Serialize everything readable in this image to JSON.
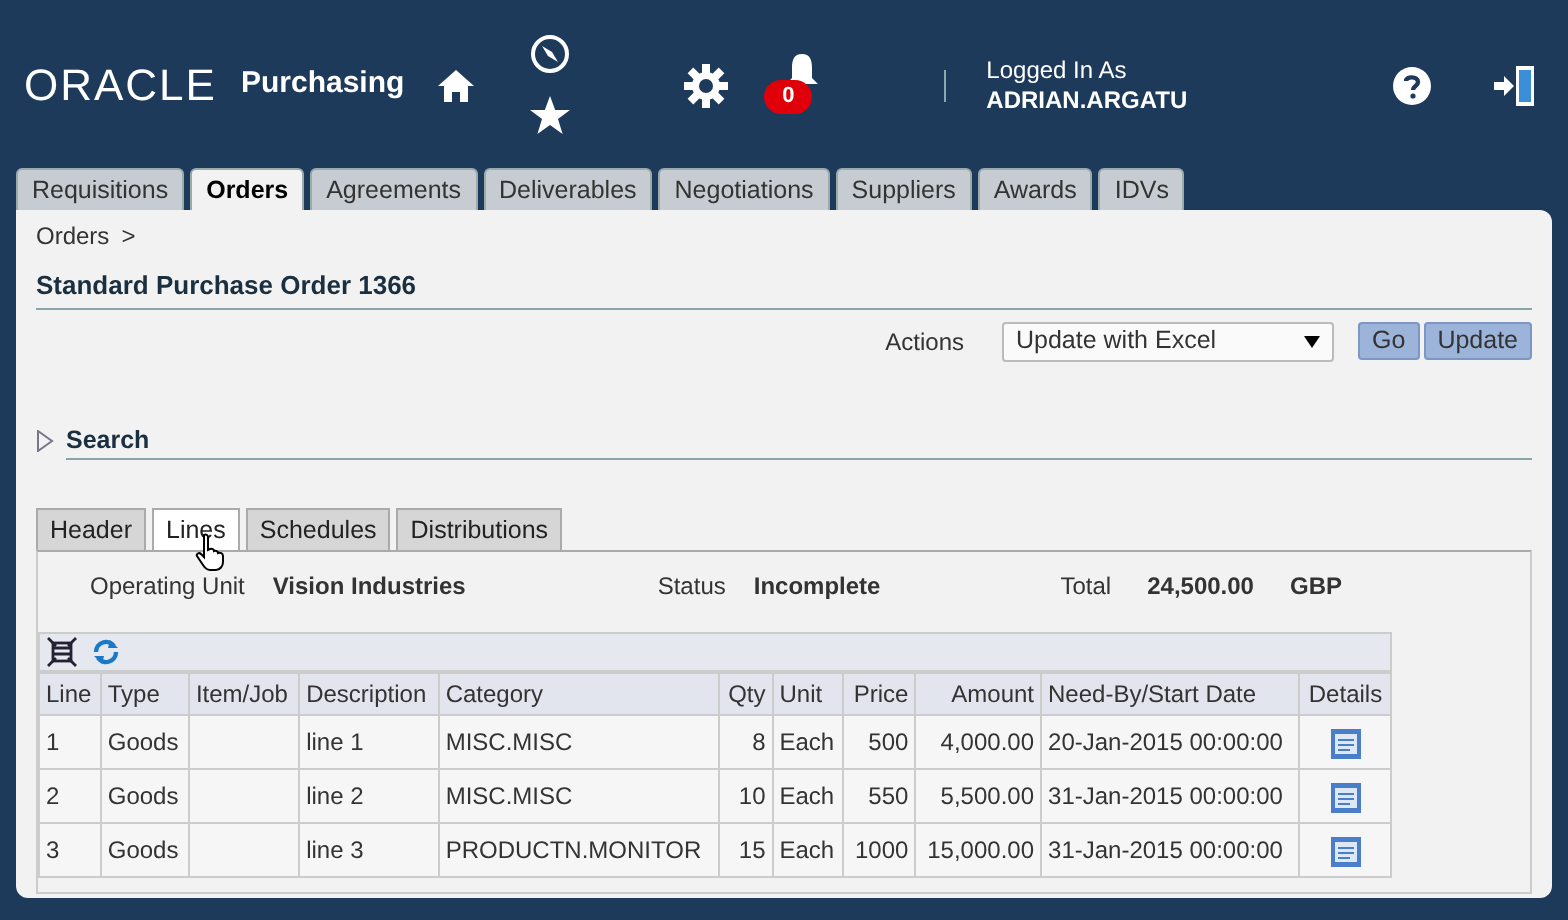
{
  "header": {
    "logo": "ORACLE",
    "app": "Purchasing",
    "notifications": "0",
    "logged_in_label": "Logged In As",
    "user": "ADRIAN.ARGATU"
  },
  "tabs": [
    {
      "label": "Requisitions",
      "selected": false
    },
    {
      "label": "Orders",
      "selected": true
    },
    {
      "label": "Agreements",
      "selected": false
    },
    {
      "label": "Deliverables",
      "selected": false
    },
    {
      "label": "Negotiations",
      "selected": false
    },
    {
      "label": "Suppliers",
      "selected": false
    },
    {
      "label": "Awards",
      "selected": false
    },
    {
      "label": "IDVs",
      "selected": false
    }
  ],
  "breadcrumb": {
    "link": "Orders",
    "separator": ">"
  },
  "title": "Standard Purchase Order 1366",
  "actions": {
    "label": "Actions",
    "value": "Update with Excel",
    "buttons": [
      "Go",
      "Update"
    ]
  },
  "search": {
    "label": "Search",
    "expanded": false
  },
  "subtabs": [
    {
      "label": "Header",
      "selected": false
    },
    {
      "label": "Lines",
      "selected": true
    },
    {
      "label": "Schedules",
      "selected": false
    },
    {
      "label": "Distributions",
      "selected": false
    }
  ],
  "summary": [
    {
      "label": "Operating Unit",
      "value": "Vision Industries"
    },
    {
      "label": "Status",
      "value": "Incomplete"
    },
    {
      "label": "Total",
      "value": "24,500.00",
      "currency": "GBP"
    }
  ],
  "table": {
    "columns": [
      {
        "label": "Line",
        "kind": "text"
      },
      {
        "label": "Type",
        "kind": "text"
      },
      {
        "label": "Item/Job",
        "kind": "text"
      },
      {
        "label": "Description",
        "kind": "text"
      },
      {
        "label": "Category",
        "kind": "text"
      },
      {
        "label": "Qty",
        "kind": "number"
      },
      {
        "label": "Unit",
        "kind": "text"
      },
      {
        "label": "Price",
        "kind": "number"
      },
      {
        "label": "Amount",
        "kind": "number"
      },
      {
        "label": "Need-By/Start Date",
        "kind": "text"
      },
      {
        "label": "Details",
        "kind": "icon"
      }
    ],
    "rows": [
      [
        "1",
        "Goods",
        "",
        "line 1",
        "MISC.MISC",
        "8",
        "Each",
        "500",
        "4,000.00",
        "20-Jan-2015 00:00:00"
      ],
      [
        "2",
        "Goods",
        "",
        "line 2",
        "MISC.MISC",
        "10",
        "Each",
        "550",
        "5,500.00",
        "31-Jan-2015 00:00:00"
      ],
      [
        "3",
        "Goods",
        "",
        "line 3",
        "PRODUCTN.MONITOR",
        "15",
        "Each",
        "1000",
        "15,000.00",
        "31-Jan-2015 00:00:00"
      ]
    ]
  }
}
